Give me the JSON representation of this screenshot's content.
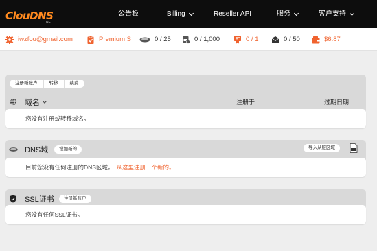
{
  "brand": {
    "logo_text": "ClouDNS",
    "logo_sub": ".NET",
    "accent": "#ff8a1f"
  },
  "nav": {
    "items": [
      {
        "label": "公告板"
      },
      {
        "label": "Billing"
      },
      {
        "label": "Reseller API"
      },
      {
        "label": "服务"
      },
      {
        "label": "客户支持"
      }
    ]
  },
  "account": {
    "email": "iwzfou@gmail.com",
    "plan": "Premium S",
    "zones": "0 / 25",
    "records": "0 / 1,000",
    "ssl": "0 / 1",
    "mail": "0 / 50",
    "balance": "$6.87"
  },
  "domains": {
    "tabs": [
      "注册新账户",
      "转移",
      "续费"
    ],
    "title": "域名",
    "col_registered": "注册于",
    "col_expires": "过期日期",
    "empty": "您没有注册或转移域名。"
  },
  "dns": {
    "title": "DNS域",
    "add_label": "增加新的",
    "import_label": "导入从服区域",
    "empty": "目前您没有任何注册的DNS区域。",
    "empty_link": "从这里注册一个新的。"
  },
  "ssl": {
    "title": "SSL证书",
    "register_label": "注册新账户",
    "empty": "您没有任何SSL证书。"
  },
  "colors": {
    "orange": "#f0632f",
    "nav_bg": "#0d0d0d",
    "panel_bg": "#d9d9d9"
  }
}
